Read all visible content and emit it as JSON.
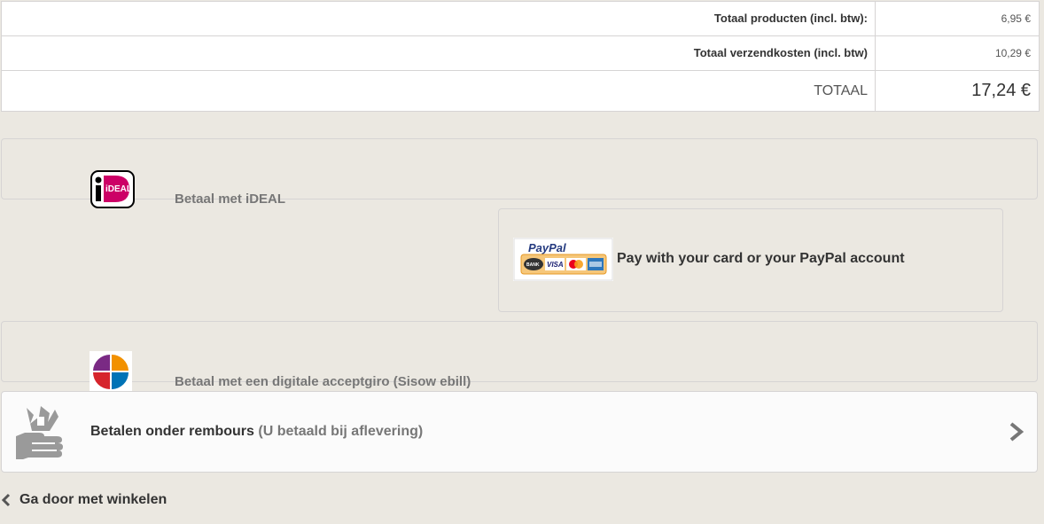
{
  "totals": {
    "products_label": "Totaal producten (incl. btw):",
    "products_value": "6,95 €",
    "shipping_label": "Totaal verzendkosten (incl. btw)",
    "shipping_value": "10,29 €",
    "total_label": "TOTAAL",
    "total_value": "17,24 €"
  },
  "payments": {
    "ideal_label": "Betaal met iDEAL",
    "ideal_logo_text": "iDEAL",
    "paypal_label": "Pay with your card or your PayPal account",
    "paypal_logo_text": "PayPal",
    "paypal_cards": [
      "BANK",
      "VISA"
    ],
    "sisow_label": "Betaal met een digitale acceptgiro (Sisow ebill)",
    "cod_label": "Betalen onder rembours",
    "cod_sublabel": "(U betaald bij aflevering)"
  },
  "nav": {
    "continue_label": "Ga door met winkelen"
  },
  "icons": {
    "ideal": "ideal-logo-icon",
    "paypal": "paypal-logo-icon",
    "sisow": "sisow-logo-icon",
    "cod": "cash-hand-icon",
    "cod_arrow": "chevron-right-icon",
    "back": "chevron-left-icon"
  },
  "colors": {
    "background": "#ebe8e1",
    "border": "#d6d4d4",
    "ideal_pink": "#cc0066",
    "paypal_blue": "#253b80",
    "sisow_purple": "#7a2a84",
    "sisow_orange": "#f29100",
    "sisow_red": "#d6242c",
    "sisow_blue": "#0073b6"
  }
}
